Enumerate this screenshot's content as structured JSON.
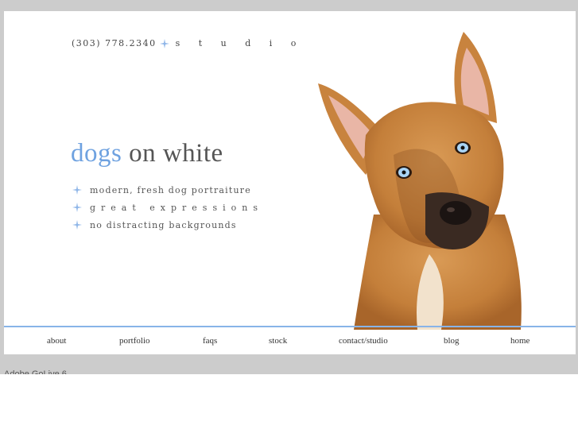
{
  "header": {
    "phone": "(303) 778.2340",
    "tagline": "s t u d i o"
  },
  "headline": {
    "accent_word": "dogs",
    "rest": "on white"
  },
  "features": [
    "modern, fresh dog portraiture",
    "great expressions",
    "no distracting backgrounds"
  ],
  "nav": {
    "items": [
      "about",
      "portfolio",
      "faqs",
      "stock",
      "contact/studio",
      "blog",
      "home"
    ]
  },
  "footer": {
    "note": "Adobe GoLive 6"
  },
  "colors": {
    "accent": "#6fa2e0",
    "rule": "#88b4e8",
    "band": "#cccccc"
  },
  "icons": {
    "bullet": "sparkle-star-icon",
    "photo": "dog-portrait"
  }
}
